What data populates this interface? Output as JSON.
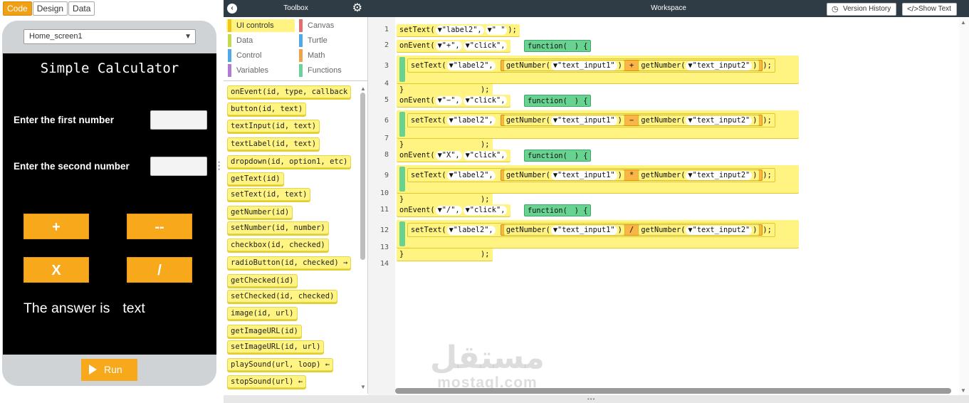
{
  "mode_tabs": [
    "Code",
    "Design",
    "Data"
  ],
  "screen_selector": {
    "value": "Home_screen1"
  },
  "app_preview": {
    "title": "Simple Calculator",
    "label_first": "Enter the first number",
    "label_second": "Enter the second  number",
    "buttons": [
      "+",
      "--",
      "X",
      "/"
    ],
    "answer_prefix": "The answer is",
    "answer_value": "text",
    "run_label": "Run"
  },
  "toolbox": {
    "title": "Toolbox",
    "categories": [
      "UI controls",
      "Canvas",
      "Data",
      "Turtle",
      "Control",
      "Math",
      "Variables",
      "Functions"
    ],
    "category_colors": [
      "#f0c419",
      "#e66b6b",
      "#c4d94e",
      "#4fa9e8",
      "#4fa9e8",
      "#f0a24a",
      "#b07bd4",
      "#6bd19c"
    ],
    "selected_category": "UI controls",
    "blocks": [
      "onEvent(id, type, callback",
      "button(id, text)",
      "textInput(id, text)",
      "textLabel(id, text)",
      "dropdown(id, option1, etc)",
      "getText(id)",
      "setText(id, text)",
      "getNumber(id)",
      "setNumber(id, number)",
      "checkbox(id, checked)",
      "radioButton(id, checked) →",
      "getChecked(id)",
      "setChecked(id, checked)",
      "image(id, url)",
      "getImageURL(id)",
      "setImageURL(id, url)",
      "playSound(url, loop) ←",
      "stopSound(url) ←"
    ]
  },
  "workspace": {
    "title": "Workspace",
    "version_history_label": "Version History",
    "show_text_label": "Show Text",
    "line_numbers": [
      "1",
      "2",
      "3",
      "4",
      "5",
      "6",
      "7",
      "8",
      "9",
      "10",
      "11",
      "12",
      "13",
      "14"
    ],
    "line1": {
      "fn": "setText(",
      "arg1": "▼\"label2\",",
      "arg2": "▼\"  \"",
      "end": ");"
    },
    "function_label": "function(",
    "events": [
      {
        "event_id": "▼\"+\",",
        "event_type": "▼\"click\",",
        "op": "+"
      },
      {
        "event_id": "▼\"−\",",
        "event_type": "▼\"click\",",
        "op": "−"
      },
      {
        "event_id": "▼\"X\",",
        "event_type": "▼\"click\",",
        "op": "*"
      },
      {
        "event_id": "▼\"/\",",
        "event_type": "▼\"click\",",
        "op": "/"
      }
    ],
    "on_event": "onEvent(",
    "set_text": "setText(",
    "label_arg": "▼\"label2\",",
    "get_number": "getNumber(",
    "input1": "▼\"text_input1\"",
    "input2": "▼\"text_input2\"",
    "close_paren": ")",
    "close_stmt": ");",
    "close_brace": "}",
    "open_brace": ") {"
  },
  "watermark": {
    "arabic": "مستقل",
    "latin": "mostaql.com"
  }
}
